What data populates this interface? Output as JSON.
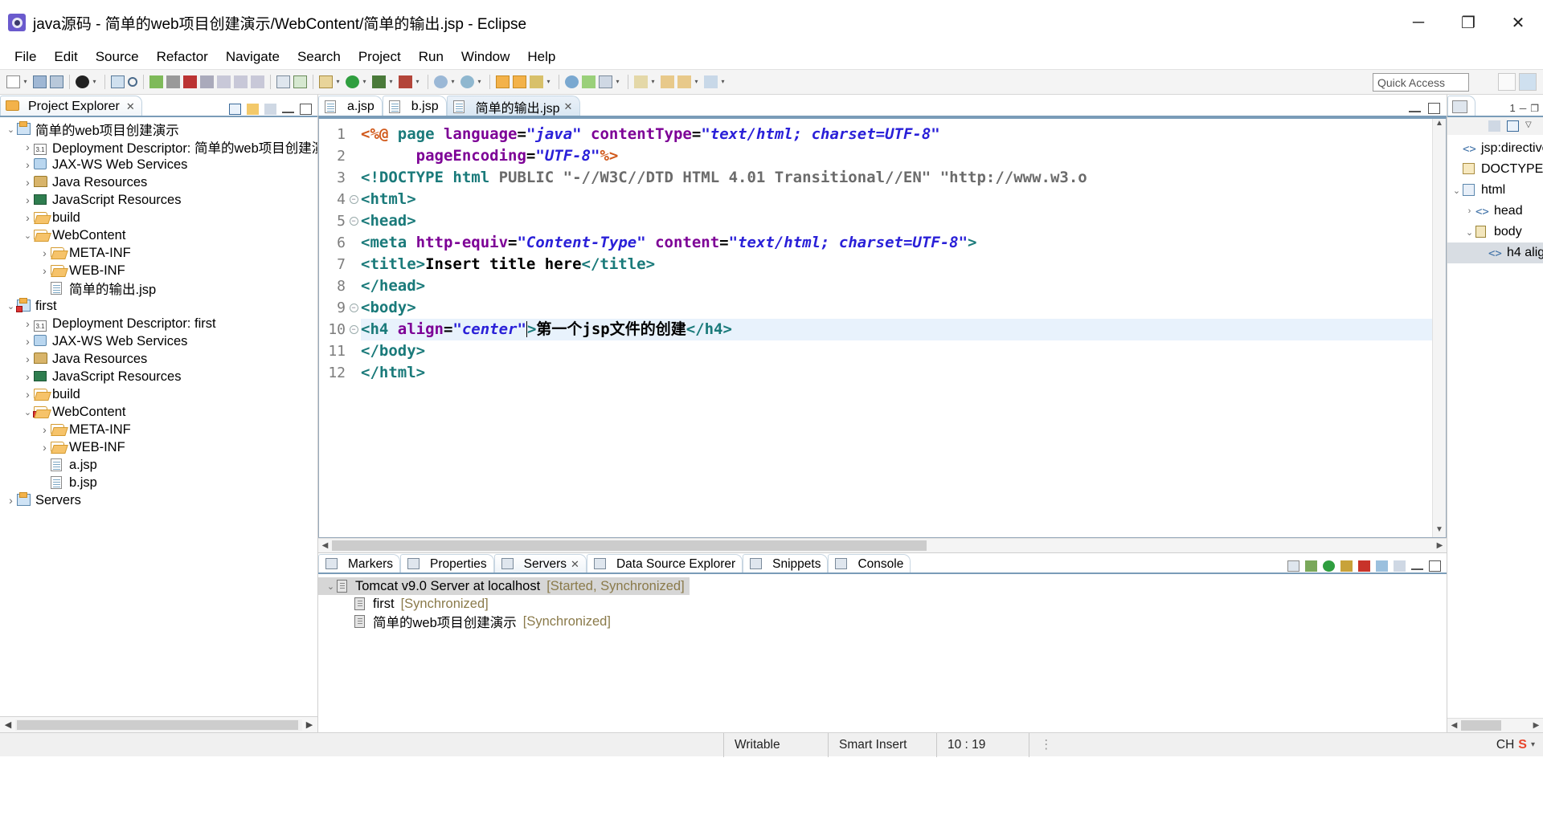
{
  "window": {
    "title": "java源码 - 简单的web项目创建演示/WebContent/简单的输出.jsp - Eclipse",
    "minimize": "─",
    "maximize": "❐",
    "close": "✕"
  },
  "menu": [
    "File",
    "Edit",
    "Source",
    "Refactor",
    "Navigate",
    "Search",
    "Project",
    "Run",
    "Window",
    "Help"
  ],
  "toolbar": {
    "quick_access_placeholder": "Quick Access"
  },
  "project_explorer": {
    "tab_label": "Project Explorer",
    "tab_close": "✕",
    "tree": [
      {
        "label": "简单的web项目创建演示",
        "indent": 0,
        "twist": "v",
        "icon": "project-icon"
      },
      {
        "label": "Deployment Descriptor: 简单的web项目创建演示",
        "indent": 1,
        "twist": ">",
        "icon": "deployment-descriptor-icon"
      },
      {
        "label": "JAX-WS Web Services",
        "indent": 1,
        "twist": ">",
        "icon": "jax-ws-icon"
      },
      {
        "label": "Java Resources",
        "indent": 1,
        "twist": ">",
        "icon": "java-resources-icon"
      },
      {
        "label": "JavaScript Resources",
        "indent": 1,
        "twist": ">",
        "icon": "javascript-resources-icon"
      },
      {
        "label": "build",
        "indent": 1,
        "twist": ">",
        "icon": "folder-icon"
      },
      {
        "label": "WebContent",
        "indent": 1,
        "twist": "v",
        "icon": "folder-icon"
      },
      {
        "label": "META-INF",
        "indent": 2,
        "twist": ">",
        "icon": "folder-icon"
      },
      {
        "label": "WEB-INF",
        "indent": 2,
        "twist": ">",
        "icon": "folder-icon"
      },
      {
        "label": "简单的输出.jsp",
        "indent": 2,
        "twist": "",
        "icon": "jsp-file-icon"
      },
      {
        "label": "first",
        "indent": 0,
        "twist": "v",
        "icon": "project-error-icon"
      },
      {
        "label": "Deployment Descriptor: first",
        "indent": 1,
        "twist": ">",
        "icon": "deployment-descriptor-icon"
      },
      {
        "label": "JAX-WS Web Services",
        "indent": 1,
        "twist": ">",
        "icon": "jax-ws-icon"
      },
      {
        "label": "Java Resources",
        "indent": 1,
        "twist": ">",
        "icon": "java-resources-icon"
      },
      {
        "label": "JavaScript Resources",
        "indent": 1,
        "twist": ">",
        "icon": "javascript-resources-icon"
      },
      {
        "label": "build",
        "indent": 1,
        "twist": ">",
        "icon": "folder-icon"
      },
      {
        "label": "WebContent",
        "indent": 1,
        "twist": "v",
        "icon": "folder-error-icon"
      },
      {
        "label": "META-INF",
        "indent": 2,
        "twist": ">",
        "icon": "folder-icon"
      },
      {
        "label": "WEB-INF",
        "indent": 2,
        "twist": ">",
        "icon": "folder-icon"
      },
      {
        "label": "a.jsp",
        "indent": 2,
        "twist": "",
        "icon": "jsp-file-icon"
      },
      {
        "label": "b.jsp",
        "indent": 2,
        "twist": "",
        "icon": "jsp-file-icon"
      },
      {
        "label": "Servers",
        "indent": 0,
        "twist": ">",
        "icon": "project-icon"
      }
    ]
  },
  "editor": {
    "tabs": [
      {
        "label": "a.jsp",
        "active": false,
        "close": ""
      },
      {
        "label": "b.jsp",
        "active": false,
        "close": ""
      },
      {
        "label": "简单的输出.jsp",
        "active": true,
        "close": "✕"
      }
    ],
    "line_numbers": [
      "1",
      "2",
      "3",
      "4",
      "5",
      "6",
      "7",
      "8",
      "9",
      "10",
      "11",
      "12"
    ],
    "fold_lines": [
      4,
      5,
      9,
      10
    ],
    "highlight_line": 10,
    "code": [
      {
        "n": 1,
        "segments": [
          {
            "t": "<%@ ",
            "c": "direc"
          },
          {
            "t": "page ",
            "c": "kw"
          },
          {
            "t": "language",
            "c": "attr"
          },
          {
            "t": "=",
            "c": "txt"
          },
          {
            "t": "\"java\"",
            "c": "str"
          },
          {
            "t": " ",
            "c": "txt"
          },
          {
            "t": "contentType",
            "c": "attr"
          },
          {
            "t": "=",
            "c": "txt"
          },
          {
            "t": "\"text/html; charset=UTF-8\"",
            "c": "str"
          }
        ]
      },
      {
        "n": 2,
        "segments": [
          {
            "t": "      ",
            "c": "txt"
          },
          {
            "t": "pageEncoding",
            "c": "attr"
          },
          {
            "t": "=",
            "c": "txt"
          },
          {
            "t": "\"UTF-8\"",
            "c": "str"
          },
          {
            "t": "%>",
            "c": "direc"
          }
        ]
      },
      {
        "n": 3,
        "segments": [
          {
            "t": "<!DOCTYPE html ",
            "c": "tag"
          },
          {
            "t": "PUBLIC ",
            "c": "dtd"
          },
          {
            "t": "\"-//W3C//DTD HTML 4.01 Transitional//EN\"",
            "c": "dtd"
          },
          {
            "t": " ",
            "c": "txt"
          },
          {
            "t": "\"http://www.w3.o",
            "c": "dtd"
          }
        ]
      },
      {
        "n": 4,
        "segments": [
          {
            "t": "<html>",
            "c": "tag"
          }
        ]
      },
      {
        "n": 5,
        "segments": [
          {
            "t": "<head>",
            "c": "tag"
          }
        ]
      },
      {
        "n": 6,
        "segments": [
          {
            "t": "<meta ",
            "c": "tag"
          },
          {
            "t": "http-equiv",
            "c": "attr"
          },
          {
            "t": "=",
            "c": "txt"
          },
          {
            "t": "\"Content-Type\"",
            "c": "str"
          },
          {
            "t": " ",
            "c": "txt"
          },
          {
            "t": "content",
            "c": "attr"
          },
          {
            "t": "=",
            "c": "txt"
          },
          {
            "t": "\"text/html; charset=UTF-8\"",
            "c": "str"
          },
          {
            "t": ">",
            "c": "tag"
          }
        ]
      },
      {
        "n": 7,
        "segments": [
          {
            "t": "<title>",
            "c": "tag"
          },
          {
            "t": "Insert title here",
            "c": "txt"
          },
          {
            "t": "</title>",
            "c": "tag"
          }
        ]
      },
      {
        "n": 8,
        "segments": [
          {
            "t": "</head>",
            "c": "tag"
          }
        ]
      },
      {
        "n": 9,
        "segments": [
          {
            "t": "<body>",
            "c": "tag"
          }
        ]
      },
      {
        "n": 10,
        "segments": [
          {
            "t": "<h4 ",
            "c": "tag"
          },
          {
            "t": "align",
            "c": "attr"
          },
          {
            "t": "=",
            "c": "txt"
          },
          {
            "t": "\"center\"",
            "c": "str"
          },
          {
            "t": "CARET",
            "c": "caret"
          },
          {
            "t": ">",
            "c": "tag"
          },
          {
            "t": "第一个jsp文件的创建",
            "c": "txt"
          },
          {
            "t": "</h4>",
            "c": "tag"
          }
        ]
      },
      {
        "n": 11,
        "segments": [
          {
            "t": "</body>",
            "c": "tag"
          }
        ]
      },
      {
        "n": 12,
        "segments": [
          {
            "t": "</html>",
            "c": "tag"
          }
        ]
      }
    ]
  },
  "bottom_view": {
    "tabs": [
      {
        "label": "Markers",
        "icon": "markers-icon",
        "active": false,
        "close": ""
      },
      {
        "label": "Properties",
        "icon": "properties-icon",
        "active": false,
        "close": ""
      },
      {
        "label": "Servers",
        "icon": "servers-icon",
        "active": true,
        "close": "✕"
      },
      {
        "label": "Data Source Explorer",
        "icon": "data-source-icon",
        "active": false,
        "close": ""
      },
      {
        "label": "Snippets",
        "icon": "snippets-icon",
        "active": false,
        "close": ""
      },
      {
        "label": "Console",
        "icon": "console-icon",
        "active": false,
        "close": ""
      }
    ],
    "rows": [
      {
        "twist": "v",
        "indent": 0,
        "label": "Tomcat v9.0 Server at localhost",
        "status": "[Started, Synchronized]",
        "selected": true
      },
      {
        "twist": "",
        "indent": 1,
        "label": "first",
        "status": "[Synchronized]",
        "selected": false
      },
      {
        "twist": "",
        "indent": 1,
        "label": "简单的web项目创建演示",
        "status": "[Synchronized]",
        "selected": false
      }
    ]
  },
  "outline": {
    "tab_badge": "1",
    "minimize": "─",
    "maximize": "❐",
    "rows": [
      {
        "indent": 0,
        "twist": "",
        "icon": "angle-icon",
        "label": "jsp:directive",
        "selected": false
      },
      {
        "indent": 0,
        "twist": "",
        "icon": "doctype-icon",
        "label": "DOCTYPE:h",
        "selected": false
      },
      {
        "indent": 0,
        "twist": "v",
        "icon": "html-icon",
        "label": "html",
        "selected": false
      },
      {
        "indent": 1,
        "twist": ">",
        "icon": "angle-icon",
        "label": "head",
        "selected": false
      },
      {
        "indent": 1,
        "twist": "v",
        "icon": "body-icon",
        "label": "body",
        "selected": false
      },
      {
        "indent": 2,
        "twist": "",
        "icon": "angle-icon",
        "label": "h4 alig",
        "selected": true
      }
    ]
  },
  "statusbar": {
    "writable": "Writable",
    "insert_mode": "Smart Insert",
    "position": "10 : 19",
    "ime_lang": "CH",
    "ime_mark": "S"
  }
}
